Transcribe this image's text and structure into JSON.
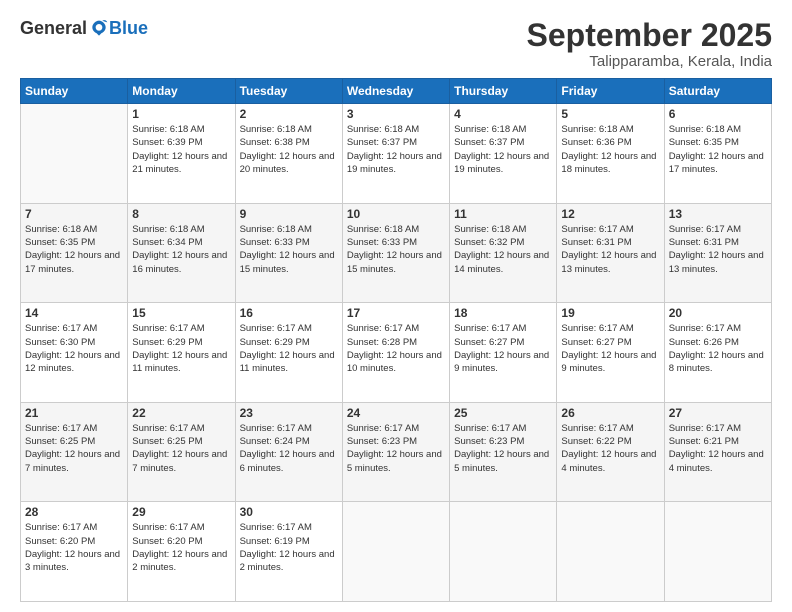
{
  "logo": {
    "general": "General",
    "blue": "Blue"
  },
  "header": {
    "month": "September 2025",
    "location": "Talipparamba, Kerala, India"
  },
  "weekdays": [
    "Sunday",
    "Monday",
    "Tuesday",
    "Wednesday",
    "Thursday",
    "Friday",
    "Saturday"
  ],
  "weeks": [
    [
      {
        "day": "",
        "sunrise": "",
        "sunset": "",
        "daylight": ""
      },
      {
        "day": "1",
        "sunrise": "Sunrise: 6:18 AM",
        "sunset": "Sunset: 6:39 PM",
        "daylight": "Daylight: 12 hours and 21 minutes."
      },
      {
        "day": "2",
        "sunrise": "Sunrise: 6:18 AM",
        "sunset": "Sunset: 6:38 PM",
        "daylight": "Daylight: 12 hours and 20 minutes."
      },
      {
        "day": "3",
        "sunrise": "Sunrise: 6:18 AM",
        "sunset": "Sunset: 6:37 PM",
        "daylight": "Daylight: 12 hours and 19 minutes."
      },
      {
        "day": "4",
        "sunrise": "Sunrise: 6:18 AM",
        "sunset": "Sunset: 6:37 PM",
        "daylight": "Daylight: 12 hours and 19 minutes."
      },
      {
        "day": "5",
        "sunrise": "Sunrise: 6:18 AM",
        "sunset": "Sunset: 6:36 PM",
        "daylight": "Daylight: 12 hours and 18 minutes."
      },
      {
        "day": "6",
        "sunrise": "Sunrise: 6:18 AM",
        "sunset": "Sunset: 6:35 PM",
        "daylight": "Daylight: 12 hours and 17 minutes."
      }
    ],
    [
      {
        "day": "7",
        "sunrise": "Sunrise: 6:18 AM",
        "sunset": "Sunset: 6:35 PM",
        "daylight": "Daylight: 12 hours and 17 minutes."
      },
      {
        "day": "8",
        "sunrise": "Sunrise: 6:18 AM",
        "sunset": "Sunset: 6:34 PM",
        "daylight": "Daylight: 12 hours and 16 minutes."
      },
      {
        "day": "9",
        "sunrise": "Sunrise: 6:18 AM",
        "sunset": "Sunset: 6:33 PM",
        "daylight": "Daylight: 12 hours and 15 minutes."
      },
      {
        "day": "10",
        "sunrise": "Sunrise: 6:18 AM",
        "sunset": "Sunset: 6:33 PM",
        "daylight": "Daylight: 12 hours and 15 minutes."
      },
      {
        "day": "11",
        "sunrise": "Sunrise: 6:18 AM",
        "sunset": "Sunset: 6:32 PM",
        "daylight": "Daylight: 12 hours and 14 minutes."
      },
      {
        "day": "12",
        "sunrise": "Sunrise: 6:17 AM",
        "sunset": "Sunset: 6:31 PM",
        "daylight": "Daylight: 12 hours and 13 minutes."
      },
      {
        "day": "13",
        "sunrise": "Sunrise: 6:17 AM",
        "sunset": "Sunset: 6:31 PM",
        "daylight": "Daylight: 12 hours and 13 minutes."
      }
    ],
    [
      {
        "day": "14",
        "sunrise": "Sunrise: 6:17 AM",
        "sunset": "Sunset: 6:30 PM",
        "daylight": "Daylight: 12 hours and 12 minutes."
      },
      {
        "day": "15",
        "sunrise": "Sunrise: 6:17 AM",
        "sunset": "Sunset: 6:29 PM",
        "daylight": "Daylight: 12 hours and 11 minutes."
      },
      {
        "day": "16",
        "sunrise": "Sunrise: 6:17 AM",
        "sunset": "Sunset: 6:29 PM",
        "daylight": "Daylight: 12 hours and 11 minutes."
      },
      {
        "day": "17",
        "sunrise": "Sunrise: 6:17 AM",
        "sunset": "Sunset: 6:28 PM",
        "daylight": "Daylight: 12 hours and 10 minutes."
      },
      {
        "day": "18",
        "sunrise": "Sunrise: 6:17 AM",
        "sunset": "Sunset: 6:27 PM",
        "daylight": "Daylight: 12 hours and 9 minutes."
      },
      {
        "day": "19",
        "sunrise": "Sunrise: 6:17 AM",
        "sunset": "Sunset: 6:27 PM",
        "daylight": "Daylight: 12 hours and 9 minutes."
      },
      {
        "day": "20",
        "sunrise": "Sunrise: 6:17 AM",
        "sunset": "Sunset: 6:26 PM",
        "daylight": "Daylight: 12 hours and 8 minutes."
      }
    ],
    [
      {
        "day": "21",
        "sunrise": "Sunrise: 6:17 AM",
        "sunset": "Sunset: 6:25 PM",
        "daylight": "Daylight: 12 hours and 7 minutes."
      },
      {
        "day": "22",
        "sunrise": "Sunrise: 6:17 AM",
        "sunset": "Sunset: 6:25 PM",
        "daylight": "Daylight: 12 hours and 7 minutes."
      },
      {
        "day": "23",
        "sunrise": "Sunrise: 6:17 AM",
        "sunset": "Sunset: 6:24 PM",
        "daylight": "Daylight: 12 hours and 6 minutes."
      },
      {
        "day": "24",
        "sunrise": "Sunrise: 6:17 AM",
        "sunset": "Sunset: 6:23 PM",
        "daylight": "Daylight: 12 hours and 5 minutes."
      },
      {
        "day": "25",
        "sunrise": "Sunrise: 6:17 AM",
        "sunset": "Sunset: 6:23 PM",
        "daylight": "Daylight: 12 hours and 5 minutes."
      },
      {
        "day": "26",
        "sunrise": "Sunrise: 6:17 AM",
        "sunset": "Sunset: 6:22 PM",
        "daylight": "Daylight: 12 hours and 4 minutes."
      },
      {
        "day": "27",
        "sunrise": "Sunrise: 6:17 AM",
        "sunset": "Sunset: 6:21 PM",
        "daylight": "Daylight: 12 hours and 4 minutes."
      }
    ],
    [
      {
        "day": "28",
        "sunrise": "Sunrise: 6:17 AM",
        "sunset": "Sunset: 6:20 PM",
        "daylight": "Daylight: 12 hours and 3 minutes."
      },
      {
        "day": "29",
        "sunrise": "Sunrise: 6:17 AM",
        "sunset": "Sunset: 6:20 PM",
        "daylight": "Daylight: 12 hours and 2 minutes."
      },
      {
        "day": "30",
        "sunrise": "Sunrise: 6:17 AM",
        "sunset": "Sunset: 6:19 PM",
        "daylight": "Daylight: 12 hours and 2 minutes."
      },
      {
        "day": "",
        "sunrise": "",
        "sunset": "",
        "daylight": ""
      },
      {
        "day": "",
        "sunrise": "",
        "sunset": "",
        "daylight": ""
      },
      {
        "day": "",
        "sunrise": "",
        "sunset": "",
        "daylight": ""
      },
      {
        "day": "",
        "sunrise": "",
        "sunset": "",
        "daylight": ""
      }
    ]
  ]
}
